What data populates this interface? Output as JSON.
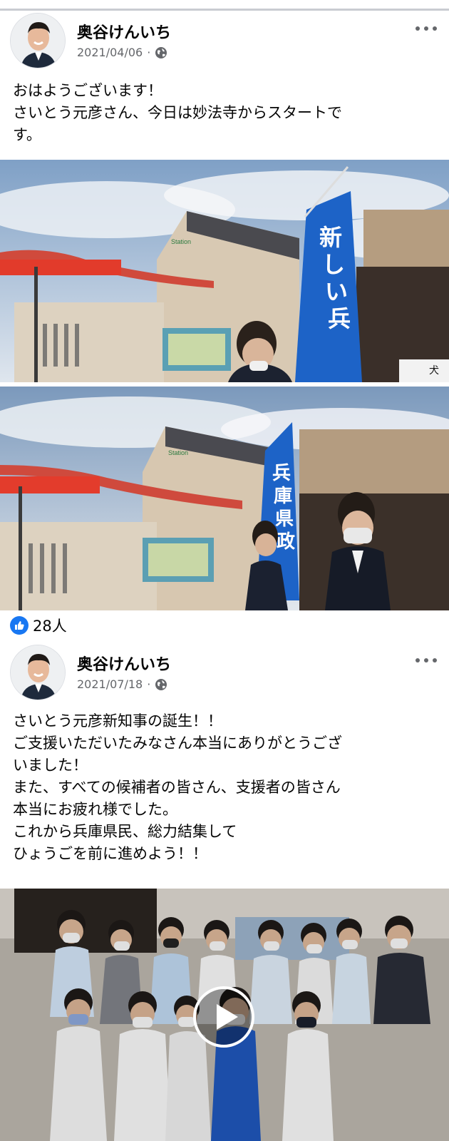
{
  "post1": {
    "author": "奥谷けんいち",
    "date": "2021/04/06",
    "separator": "·",
    "text_lines": [
      "おはようございます！",
      "さいとう元彦さん、今日は妙法寺からスタートで",
      "す。"
    ],
    "banner_text": "新しい兵庫県政に",
    "reaction_count": "28人"
  },
  "post2": {
    "author": "奥谷けんいち",
    "date": "2021/07/18",
    "separator": "·",
    "text_lines": [
      "さいとう元彦新知事の誕生！！",
      "ご支援いただいたみなさん本当にありがとうござ",
      "いました！",
      "また、すべての候補者の皆さん、支援者の皆さん",
      "本当にお疲れ様でした。",
      "これから兵庫県民、総力結集して",
      "ひょうごを前に進めよう！！"
    ]
  },
  "icons": {
    "globe": "globe-icon",
    "more": "more-options-icon",
    "like": "thumbs-up-icon",
    "play": "play-icon"
  },
  "colors": {
    "like_blue": "#1877f2",
    "meta_gray": "#65676b",
    "banner_blue": "#1d63c7"
  }
}
